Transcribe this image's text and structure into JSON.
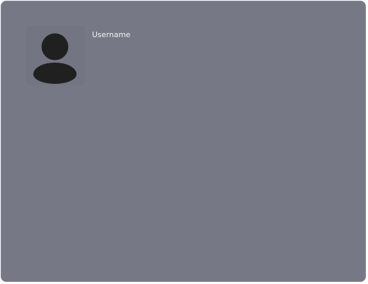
{
  "profile": {
    "username": "Username",
    "avatar_icon": "user-silhouette-icon"
  },
  "colors": {
    "card_background": "#767885",
    "avatar_fill": "#202020",
    "text": "#f4f4f7"
  }
}
